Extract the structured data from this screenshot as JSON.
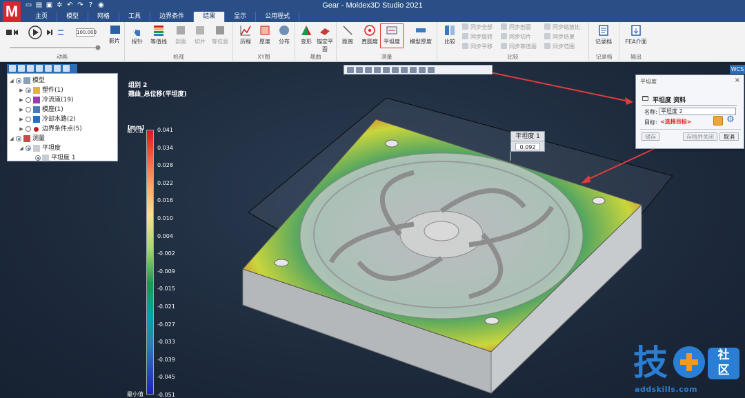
{
  "window": {
    "title": "Gear - Moldex3D Studio 2021",
    "logo": "M"
  },
  "quick_access": [
    "new-icon",
    "open-icon",
    "save-icon",
    "settings-icon",
    "undo-icon",
    "redo-icon",
    "help-icon",
    "camera-icon"
  ],
  "tabs": [
    {
      "label": "主页"
    },
    {
      "label": "模型"
    },
    {
      "label": "网格"
    },
    {
      "label": "工具"
    },
    {
      "label": "边界条件"
    },
    {
      "label": "结果",
      "active": true
    },
    {
      "label": "显示"
    },
    {
      "label": "公用程式"
    }
  ],
  "ribbon": {
    "animation": {
      "label": "动画",
      "frame_value": "100.000",
      "movie_label": "影片"
    },
    "inspect": {
      "label": "检视",
      "buttons": [
        "探针",
        "等值线",
        "剖面",
        "切片",
        "等位面"
      ]
    },
    "xy": {
      "label": "XY图",
      "buttons": [
        "历程",
        "厚度",
        "分布"
      ]
    },
    "warp": {
      "label": "翘曲",
      "buttons": [
        "变形",
        "锚定平面"
      ]
    },
    "measure": {
      "label": "测量",
      "buttons": [
        "距离",
        "真圆度",
        "平坦度",
        "模型厚度"
      ]
    },
    "compare": {
      "label": "比较",
      "main": "比较",
      "sync_col1": [
        "同步全部",
        "同步旋转",
        "同步平移"
      ],
      "sync_col2": [
        "同步剖面",
        "同步切片",
        "同步等值面"
      ],
      "sync_col3": [
        "同步缩放比",
        "同步结果",
        "同步范围"
      ]
    },
    "record": {
      "label": "记录档",
      "button": "记录档"
    },
    "output": {
      "label": "输出",
      "button": "FEA介面"
    }
  },
  "viewport": {
    "wcs_label": "WCS"
  },
  "tree": {
    "items": [
      {
        "label": "模型",
        "level": 0,
        "expanded": true
      },
      {
        "label": "塑件(1)",
        "level": 1
      },
      {
        "label": "冷流道(19)",
        "level": 1
      },
      {
        "label": "模座(1)",
        "level": 1
      },
      {
        "label": "冷却水路(2)",
        "level": 1
      },
      {
        "label": "边界条件点(5)",
        "level": 1
      },
      {
        "label": "测量",
        "level": 0,
        "expanded": true
      },
      {
        "label": "平坦度",
        "level": 1
      },
      {
        "label": "平坦度 1",
        "level": 2
      }
    ]
  },
  "result": {
    "group": "组别 2",
    "name": "翘曲_总位移(平坦度)"
  },
  "legend": {
    "unit": "[mm]",
    "max_label": "最大值",
    "min_label": "最小值",
    "ticks": [
      "0.041",
      "0.034",
      "0.028",
      "0.022",
      "0.016",
      "0.010",
      "0.004",
      "-0.002",
      "-0.009",
      "-0.015",
      "-0.021",
      "-0.027",
      "-0.033",
      "-0.039",
      "-0.045",
      "-0.051"
    ]
  },
  "probe": {
    "title": "平坦度 1",
    "value": "0.092"
  },
  "dialog": {
    "title": "平坦度",
    "close": "×",
    "section": "平坦度 资料",
    "name_label": "名称:",
    "name_value": "平坦度 2",
    "target_label": "目标:",
    "target_value": "<选择目标>",
    "buttons": {
      "save": "储存",
      "save_close": "存档并关闭",
      "cancel": "取消"
    }
  },
  "watermark": {
    "char1": "技",
    "char2": "社\n区",
    "url": "addskills.com"
  }
}
